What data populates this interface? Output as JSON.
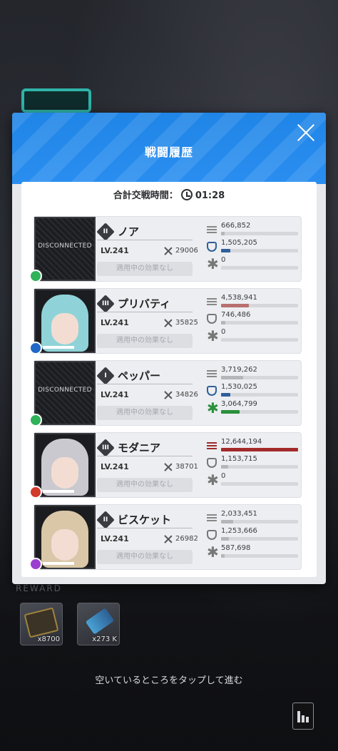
{
  "modal": {
    "title": "戦闘履歴",
    "combat_time_label": "合計交戦時間：",
    "combat_time": "01:28"
  },
  "colors": {
    "header": "#2a8ef0",
    "damage_top": "#a32a2a",
    "shield_top": "#2f5f9a",
    "heal_top": "#2a8f3c",
    "gray_bar": "#b4b6ba"
  },
  "characters": [
    {
      "name": "ノア",
      "rank": "II",
      "level": "LV.241",
      "power": "29006",
      "status": "適用中の効果なし",
      "portrait": "DISCONNECTED",
      "element": "wind-icon",
      "element_color": "#2fb35a",
      "damage": "666,852",
      "damage_frac": 0.05,
      "damage_top": false,
      "shield": "1,505,205",
      "shield_frac": 0.12,
      "shield_top": true,
      "heal": "0",
      "heal_frac": 0,
      "heal_top": false
    },
    {
      "name": "プリバティ",
      "rank": "III",
      "level": "LV.241",
      "power": "35825",
      "status": "適用中の効果なし",
      "portrait": "",
      "element": "water-icon",
      "element_color": "#2068c8",
      "damage": "4,538,941",
      "damage_frac": 0.36,
      "damage_top": false,
      "shield": "746,486",
      "shield_frac": 0.06,
      "shield_top": false,
      "heal": "0",
      "heal_frac": 0,
      "heal_top": false
    },
    {
      "name": "ペッパー",
      "rank": "I",
      "level": "LV.241",
      "power": "34826",
      "status": "適用中の効果なし",
      "portrait": "DISCONNECTED",
      "element": "wind-icon",
      "element_color": "#2fb35a",
      "damage": "3,719,262",
      "damage_frac": 0.29,
      "damage_top": false,
      "shield": "1,530,025",
      "shield_frac": 0.12,
      "shield_top": true,
      "heal": "3,064,799",
      "heal_frac": 0.24,
      "heal_top": true
    },
    {
      "name": "モダニア",
      "rank": "III",
      "level": "LV.241",
      "power": "38701",
      "status": "適用中の効果なし",
      "portrait": "",
      "element": "fire-icon",
      "element_color": "#d23a2a",
      "damage": "12,644,194",
      "damage_frac": 1.0,
      "damage_top": true,
      "shield": "1,153,715",
      "shield_frac": 0.09,
      "shield_top": false,
      "heal": "0",
      "heal_frac": 0,
      "heal_top": false
    },
    {
      "name": "ビスケット",
      "rank": "II",
      "level": "LV.241",
      "power": "26982",
      "status": "適用中の効果なし",
      "portrait": "",
      "element": "electric-icon",
      "element_color": "#9a3fd0",
      "damage": "2,033,451",
      "damage_frac": 0.16,
      "damage_top": false,
      "shield": "1,253,666",
      "shield_frac": 0.1,
      "shield_top": false,
      "heal": "587,698",
      "heal_frac": 0.05,
      "heal_top": false
    }
  ],
  "rewards": {
    "label": "REWARD",
    "items": [
      {
        "icon": "card-icon",
        "qty": "x8700"
      },
      {
        "icon": "usb-icon",
        "qty": "x273 K"
      }
    ]
  },
  "footer": {
    "hint": "空いているところをタップして進む",
    "stats_button": "stats-icon"
  }
}
